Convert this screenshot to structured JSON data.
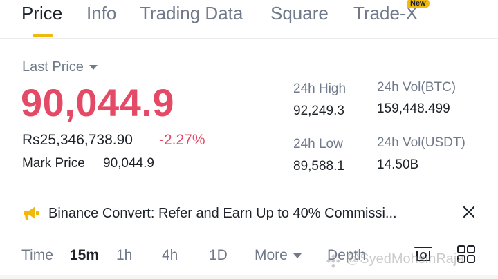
{
  "tabs": [
    {
      "label": "Price",
      "active": true
    },
    {
      "label": "Info"
    },
    {
      "label": "Trading Data"
    },
    {
      "label": "Square"
    },
    {
      "label": "Trade-X",
      "badge": "New"
    }
  ],
  "price": {
    "selector_label": "Last Price",
    "last_price": "90,044.9",
    "local_price": "Rs25,346,738.90",
    "change_pct": "-2.27%",
    "mark_price_label": "Mark Price",
    "mark_price_value": "90,044.9"
  },
  "stats": {
    "high_label": "24h High",
    "high_value": "92,249.3",
    "vol_btc_label": "24h Vol(BTC)",
    "vol_btc_value": "159,448.499",
    "low_label": "24h Low",
    "low_value": "89,588.1",
    "vol_usdt_label": "24h Vol(USDT)",
    "vol_usdt_value": "14.50B"
  },
  "banner": {
    "text": "Binance Convert: Refer and Earn Up to 40% Commissi...",
    "icon": "megaphone-icon",
    "close_icon": "close-icon"
  },
  "intervals": {
    "time": "Time",
    "items": [
      "15m",
      "1h",
      "4h",
      "1D"
    ],
    "active": "15m",
    "more": "More",
    "depth": "Depth"
  },
  "watermark": "@SyedMohsinRaja",
  "colors": {
    "accent": "#f0b90b",
    "negative": "#e44a66",
    "text_primary": "#1e2329",
    "text_secondary": "#707a8a"
  }
}
